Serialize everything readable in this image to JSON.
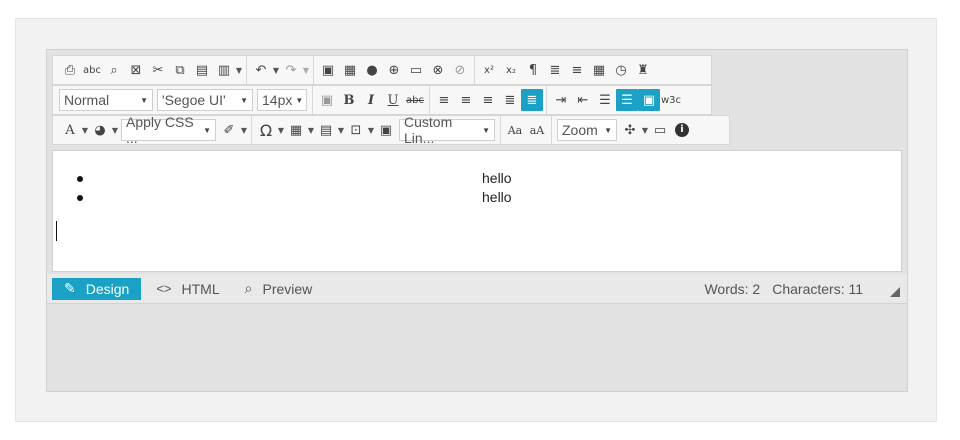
{
  "toolbar": {
    "row1": [
      [
        "print-icon",
        "spellcheck-icon",
        "find-icon",
        "select-all-icon",
        "cut-icon",
        "copy-icon",
        "paste-icon",
        "paste-options-icon",
        "undo-icon",
        "redo-icon"
      ],
      [
        "image-icon",
        "image-map-icon",
        "flash-icon",
        "media-icon",
        "document-icon",
        "hyperlink-icon",
        "remove-link-icon"
      ],
      [
        "superscript-icon",
        "subscript-icon",
        "paragraph-icon",
        "spell-icon",
        "horizontal-rule-icon",
        "insert-date-icon",
        "insert-time-icon",
        "format-stripper-icon"
      ]
    ],
    "row1_glyphs": {
      "print-icon": "⎙",
      "spellcheck-icon": "✓",
      "find-icon": "⌕",
      "select-all-icon": "⊡",
      "cut-icon": "✂",
      "copy-icon": "⧉",
      "paste-icon": "📋",
      "paste-options-icon": "▤",
      "undo-icon": "↶",
      "redo-icon": "↷",
      "image-icon": "🖼",
      "image-map-icon": "▦",
      "flash-icon": "◉",
      "media-icon": "⊕",
      "document-icon": "▭",
      "hyperlink-icon": "🔗",
      "remove-link-icon": "⛓",
      "superscript-icon": "x²",
      "subscript-icon": "x₂",
      "paragraph-icon": "¶",
      "spell-icon": "≣",
      "horizontal-rule-icon": "≡",
      "insert-date-icon": "▦",
      "insert-time-icon": "◷",
      "format-stripper-icon": "♜"
    },
    "paragraph_style": "Normal",
    "font_family": "'Segoe UI'",
    "font_size": "14px",
    "row2_icons": [
      "bold",
      "italic",
      "underline",
      "strike",
      "align-left",
      "align-center",
      "align-right",
      "justify",
      "justify-none",
      "indent",
      "outdent",
      "numbered-list",
      "bulleted-list",
      "template",
      "xhtml-validator"
    ],
    "row2_glyphs": {
      "bold": "B",
      "italic": "I",
      "underline": "U",
      "strike": "abc",
      "align-left": "≡",
      "align-center": "≡",
      "align-right": "≡",
      "justify": "≣",
      "justify-none": "≣",
      "indent": "⇥",
      "outdent": "⇤",
      "numbered-list": "⁝≡",
      "bulleted-list": "⁝≡",
      "template": "▣",
      "xhtml-validator": "w3c"
    },
    "css_class": "Apply CSS ...",
    "custom_links": "Custom Lin...",
    "zoom": "Zoom",
    "font_color_glyph": "A",
    "background_color_glyph": "◕",
    "format_painter_glyph": "✐",
    "special_char_glyph": "Ω",
    "table_glyph": "▦",
    "table_props_glyph": "▤",
    "insert_glyph": "⊡",
    "image_manager_glyph": "▣",
    "convert_lower_label": "Aa",
    "convert_upper_label": "aA",
    "module_manager_glyph": "✣",
    "toggle_screen_glyph": "▭",
    "about_glyph": "i"
  },
  "content": {
    "items": [
      "hello",
      "hello"
    ]
  },
  "modes": {
    "design": "Design",
    "html": "HTML",
    "preview": "Preview",
    "design_icon": "✎",
    "html_icon": "<>",
    "preview_icon": "⌕"
  },
  "status": {
    "words": "Words: 2",
    "characters": "Characters: 11"
  },
  "colors": {
    "accent": "#1ba1c5"
  }
}
